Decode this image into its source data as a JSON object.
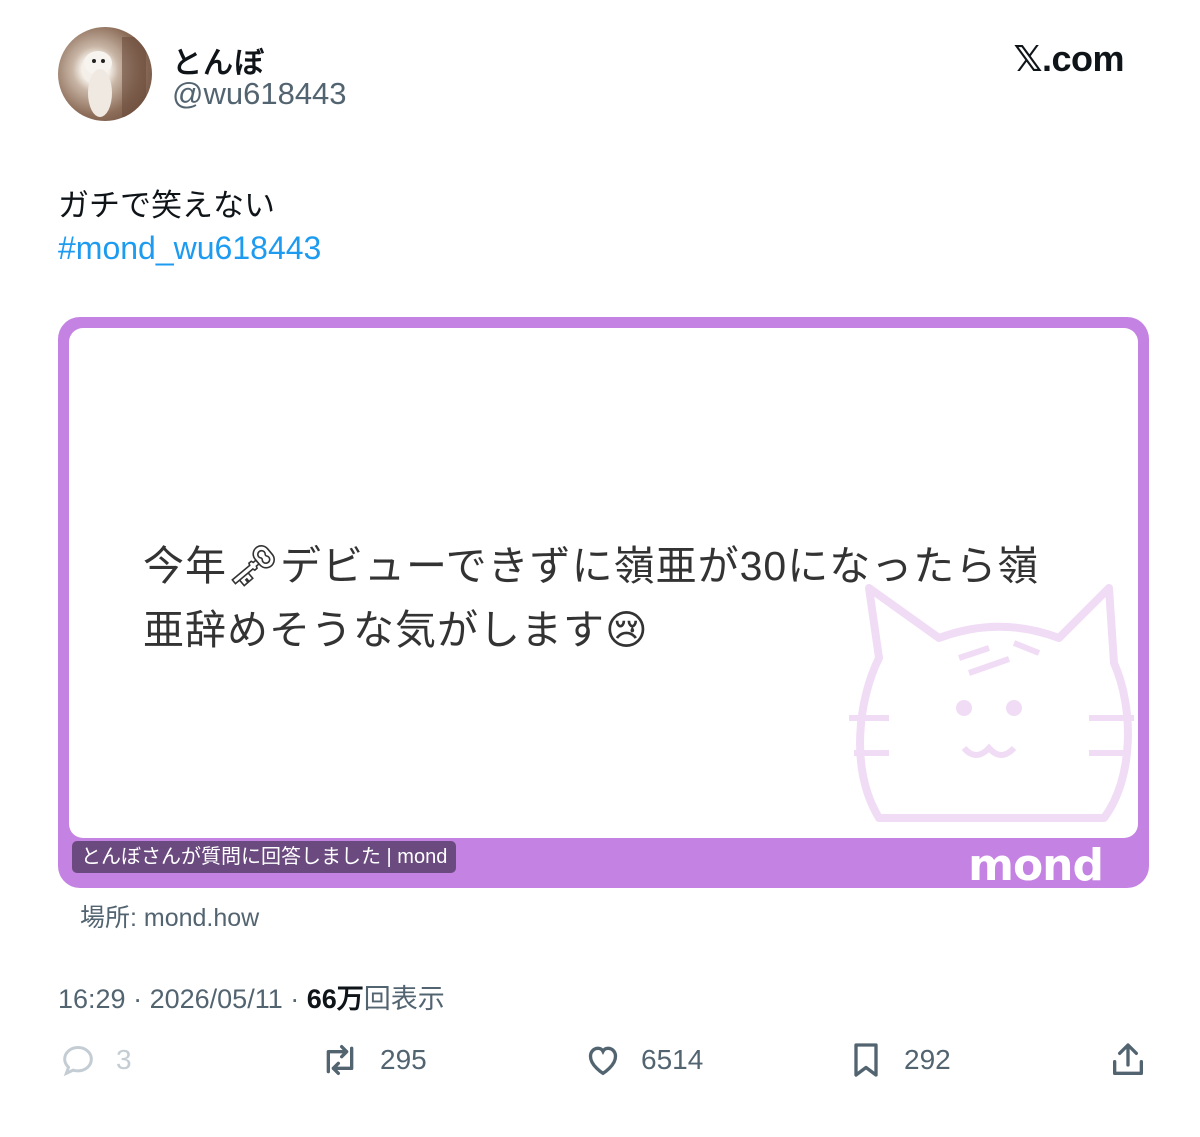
{
  "user": {
    "display_name": "とんぼ",
    "handle": "@wu618443"
  },
  "brand": "𝕏.com",
  "tweet": {
    "text": "ガチで笑えない",
    "hashtag": "#mond_wu618443"
  },
  "card": {
    "question_line1": "今年🗝デビューできずに嶺亜が30になったら嶺",
    "question_line2": "亜辞めそうな気がします😢",
    "caption": "とんぼさんが質問に回答しました | mond",
    "logo": "mond",
    "border_color": "#c483e2"
  },
  "location": "場所: mond.how",
  "meta": {
    "time": "16:29",
    "date": "2026/05/11",
    "views_count": "66万",
    "views_label": "回表示"
  },
  "actions": {
    "reply_count": "3",
    "retweet_count": "295",
    "like_count": "6514",
    "bookmark_count": "292"
  },
  "colors": {
    "hashtag": "#1d9bf0",
    "secondary_text": "#536471"
  }
}
